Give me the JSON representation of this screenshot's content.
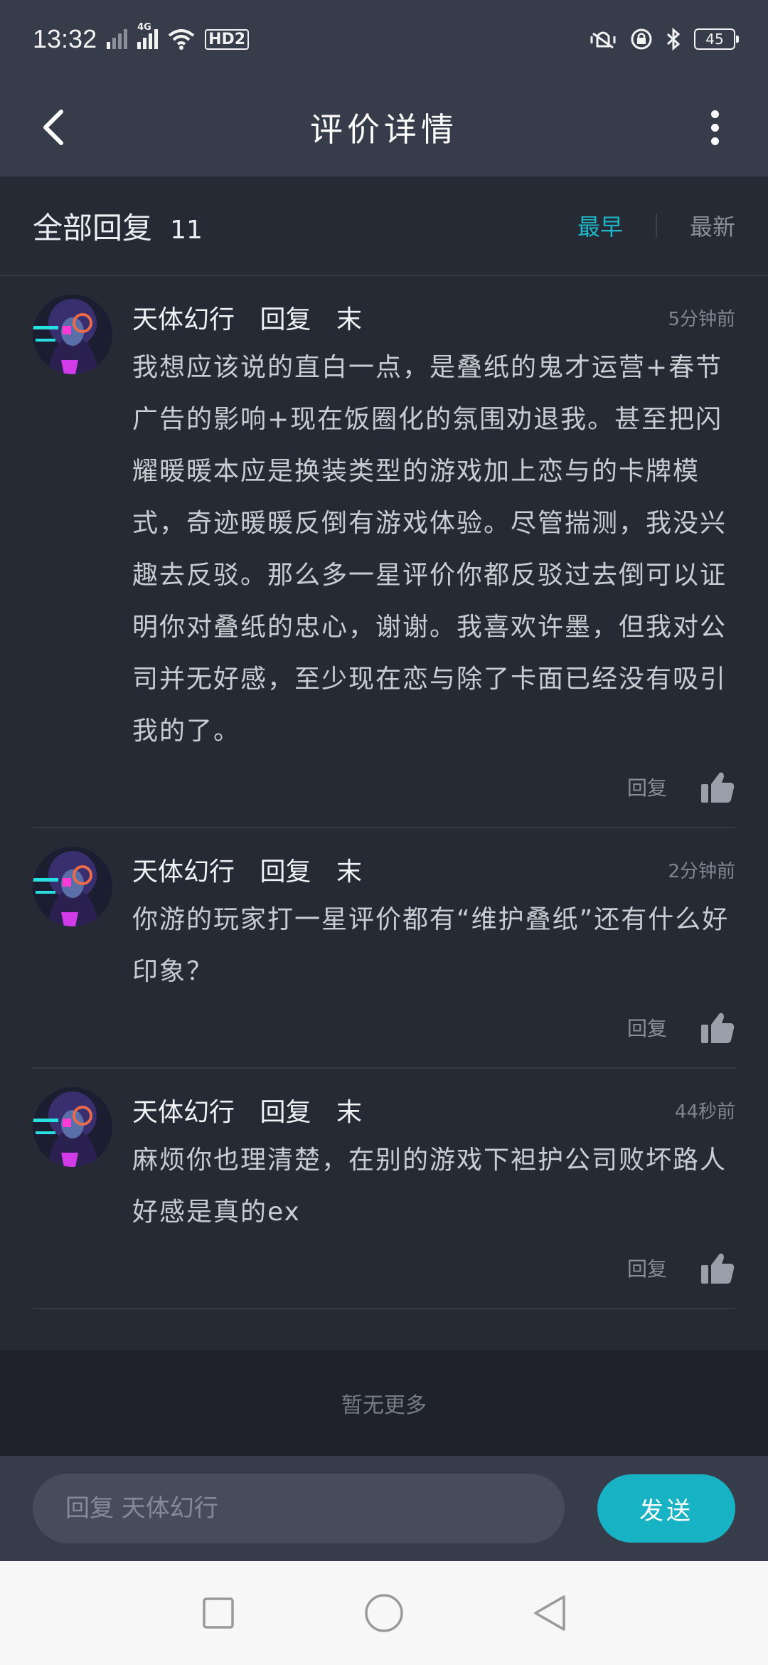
{
  "status_bar": {
    "time": "13:32",
    "network": "4G",
    "hd": "HD2",
    "battery": "45",
    "icons": [
      "signal-icon",
      "wifi-icon",
      "vibrate-icon",
      "lock-rotation-icon",
      "bluetooth-icon",
      "battery-icon"
    ]
  },
  "nav": {
    "title": "评价详情",
    "back_icon": "chevron-left-icon",
    "more_icon": "more-vertical-icon"
  },
  "replies_header": {
    "title": "全部回复",
    "count": "11",
    "sort_earliest": "最早",
    "sort_latest": "最新",
    "active_sort": "最早"
  },
  "replies": [
    {
      "user": "天体幻行",
      "action": "回复",
      "target": "末",
      "time": "5分钟前",
      "text": "我想应该说的直白一点，是叠纸的鬼才运营+春节广告的影响+现在饭圈化的氛围劝退我。甚至把闪耀暖暖本应是换装类型的游戏加上恋与的卡牌模式，奇迹暖暖反倒有游戏体验。尽管揣测，我没兴趣去反驳。那么多一星评价你都反驳过去倒可以证明你对叠纸的忠心，谢谢。我喜欢许墨，但我对公司并无好感，至少现在恋与除了卡面已经没有吸引我的了。",
      "reply_label": "回复"
    },
    {
      "user": "天体幻行",
      "action": "回复",
      "target": "末",
      "time": "2分钟前",
      "text": "你游的玩家打一星评价都有“维护叠纸”还有什么好印象？",
      "reply_label": "回复"
    },
    {
      "user": "天体幻行",
      "action": "回复",
      "target": "末",
      "time": "44秒前",
      "text": "麻烦你也理清楚，在别的游戏下袒护公司败坏路人好感是真的ex",
      "reply_label": "回复"
    }
  ],
  "no_more": "暂无更多",
  "reply_bar": {
    "placeholder": "回复 天体幻行",
    "send_label": "发送"
  },
  "colors": {
    "accent": "#17b3c4",
    "header_bg": "#363c49",
    "page_bg": "#262a35"
  }
}
